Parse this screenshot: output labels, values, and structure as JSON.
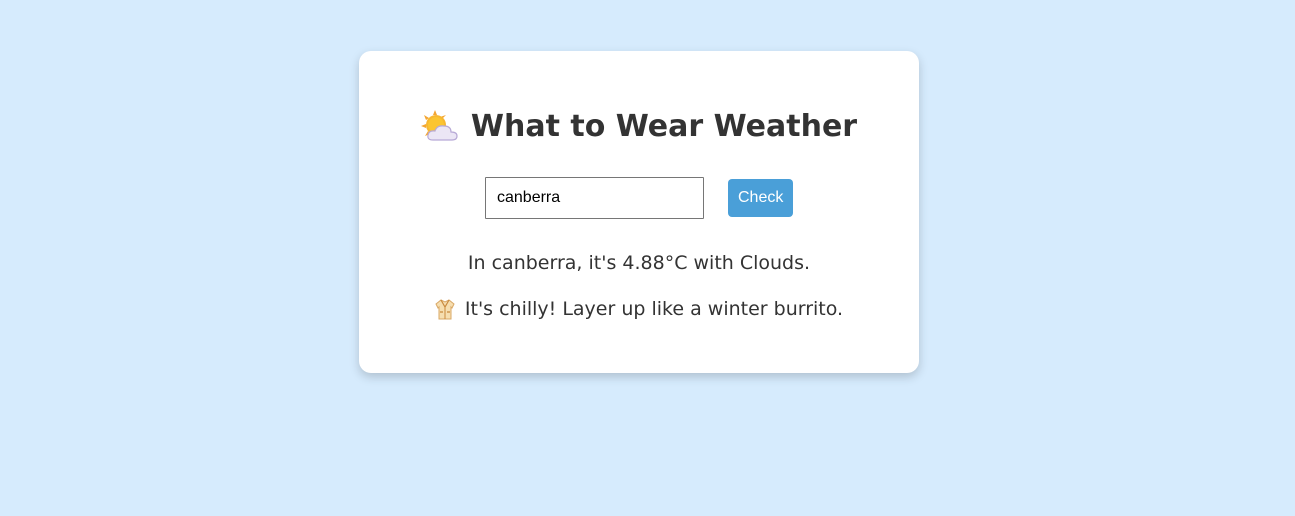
{
  "app": {
    "title": "What to Wear Weather",
    "title_icon": "sun-behind-cloud-icon"
  },
  "search": {
    "value": "canberra",
    "button_label": "Check"
  },
  "result": {
    "weather_text": "In canberra, it's 4.88°C with Clouds.",
    "advice_icon": "coat-icon",
    "advice_text": "It's chilly! Layer up like a winter burrito."
  },
  "colors": {
    "background": "#d6ebfd",
    "card": "#ffffff",
    "accent_button": "#4a9fd8",
    "text": "#333333"
  }
}
